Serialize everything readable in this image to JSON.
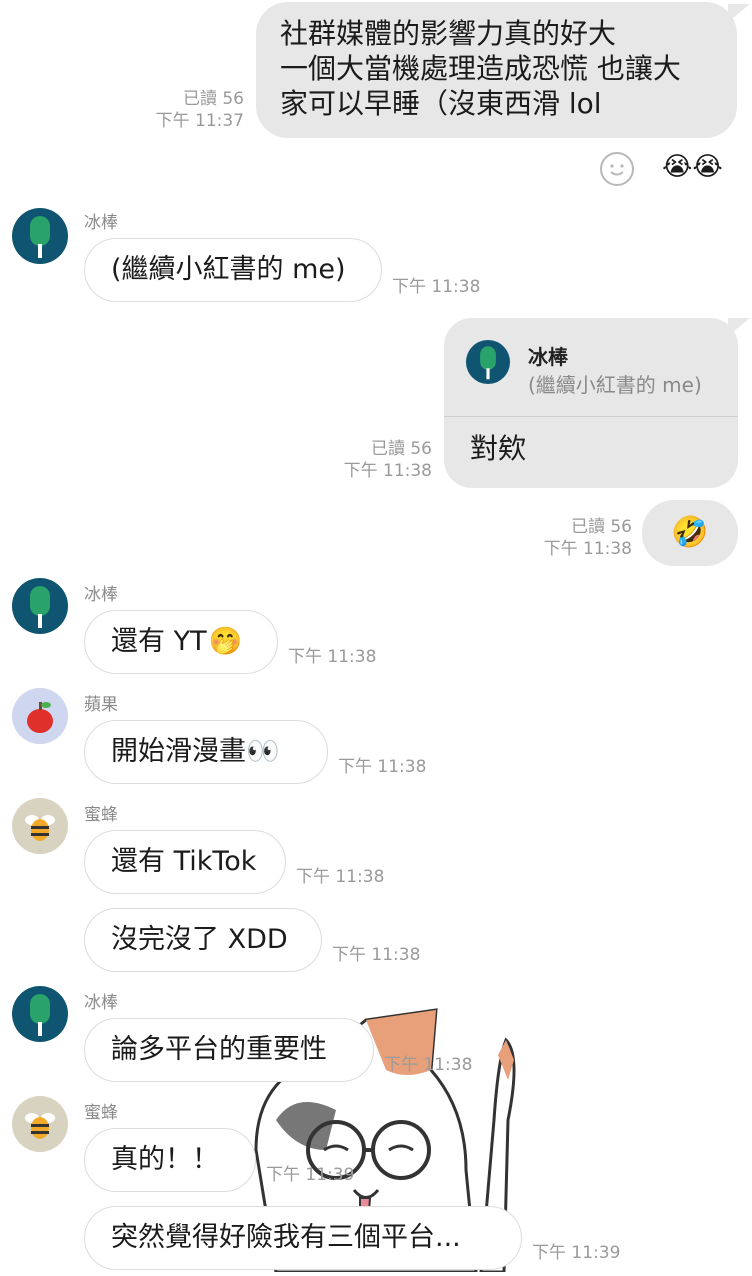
{
  "messages": {
    "m1": {
      "lines": [
        "社群媒體的影響力真的好大",
        "一個大當機處理造成恐慌 也讓大",
        "家可以早睡（沒東西滑 lol"
      ],
      "read": "已讀 56",
      "time": "下午 11:37"
    },
    "m2": {
      "sender": "冰棒",
      "text": "(繼續小紅書的 me)",
      "time": "下午 11:38"
    },
    "m3": {
      "quote_name": "冰棒",
      "quote_text": "(繼續小紅書的 me)",
      "text": "對欸",
      "read": "已讀 56",
      "time": "下午 11:38"
    },
    "m4": {
      "text": "🤣",
      "read": "已讀 56",
      "time": "下午 11:38"
    },
    "m5": {
      "sender": "冰棒",
      "text": "還有 YT",
      "emoji": "🤭",
      "time": "下午 11:38"
    },
    "m6": {
      "sender": "蘋果",
      "text": "開始滑漫畫",
      "emoji": "👀",
      "time": "下午 11:38"
    },
    "m7": {
      "sender": "蜜蜂",
      "text": "還有 TikTok",
      "time": "下午 11:38"
    },
    "m8": {
      "text": "沒完沒了 XDD",
      "time": "下午 11:38"
    },
    "m9": {
      "sender": "冰棒",
      "text": "論多平台的重要性",
      "time": "下午 11:38"
    },
    "m10": {
      "sender": "蜜蜂",
      "text": "真的！！",
      "time": "下午 11:39"
    },
    "m11": {
      "text": "突然覺得好險我有三個平台...",
      "time": "下午 11:39"
    }
  },
  "reactions": {
    "smiley_icon": "smiley-face",
    "reaction_emoji": "😭😭"
  },
  "colors": {
    "bubble_out": "#e7e7e7",
    "avatar_green": "#1f8a5a",
    "avatar_dark": "#0f5470"
  }
}
